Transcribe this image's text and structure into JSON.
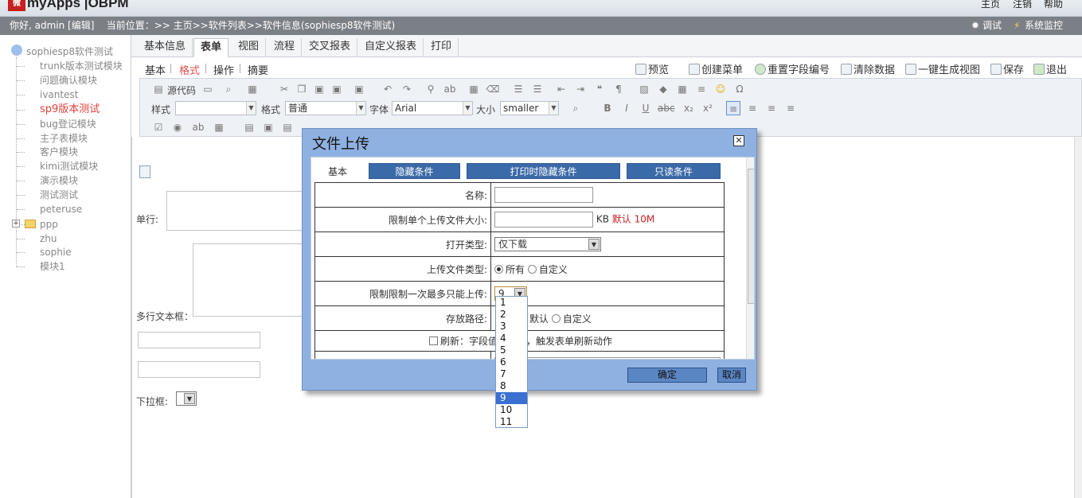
{
  "app": {
    "logo_text": "myApps",
    "product": "OBPM"
  },
  "top_links": [
    "主页",
    "注销",
    "帮助"
  ],
  "infobar": {
    "greeting": "你好, admin [编辑]",
    "location": "当前位置：>> 主页>>软件列表>>软件信息(sophiesp8软件测试)",
    "debug": "调试",
    "monitor": "系统监控"
  },
  "tree": {
    "root": "sophiesp8软件测试",
    "items": [
      "trunk版本测试模块",
      "问题确认模块",
      "ivantest",
      "sp9版本测试",
      "bug登记模块",
      "主子表模块",
      "客户模块",
      "kimi测试模块",
      "演示模块",
      "测试测试",
      "peteruse",
      "ppp",
      "zhu",
      "sophie",
      "模块1"
    ],
    "active_index": 3
  },
  "tabs": [
    "基本信息",
    "表单",
    "视图",
    "流程",
    "交叉报表",
    "自定义报表",
    "打印"
  ],
  "subtabs": [
    "基本",
    "格式",
    "操作",
    "摘要"
  ],
  "actions": [
    "预览",
    "创建菜单",
    "重置字段编号",
    "清除数据",
    "一键生成视图",
    "保存",
    "退出"
  ],
  "editor": {
    "source_label": "源代码",
    "style_label": "样式",
    "style_value": "",
    "format_label": "格式",
    "format_value": "普通",
    "font_label": "字体",
    "font_value": "Arial",
    "size_label": "大小",
    "size_value": "smaller"
  },
  "canvas": {
    "single_line": "单行:",
    "multi_line": "多行文本框：",
    "dropdown": "下拉框:"
  },
  "dialog": {
    "title": "文件上传",
    "tabs": [
      "基本",
      "隐藏条件",
      "打印时隐藏条件",
      "只读条件"
    ],
    "fields": {
      "name": "名称:",
      "max_size": "限制单个上传文件大小:",
      "kb": "KB",
      "default_hint": "默认 10M",
      "open_type": "打开类型:",
      "open_type_value": "仅下载",
      "upload_type": "上传文件类型:",
      "all": "所有",
      "custom": "自定义",
      "max_count": "限制限制一次最多只能上传:",
      "max_count_value": "9",
      "path": "存放路径:",
      "path_default": "默认",
      "path_custom": "自定义",
      "refresh": "刷新：字段值改变时，触发表单刷新动作"
    },
    "ok": "确定",
    "cancel": "取消",
    "options": [
      "1",
      "2",
      "3",
      "4",
      "5",
      "6",
      "7",
      "8",
      "9",
      "10",
      "11"
    ],
    "highlighted": "9"
  }
}
